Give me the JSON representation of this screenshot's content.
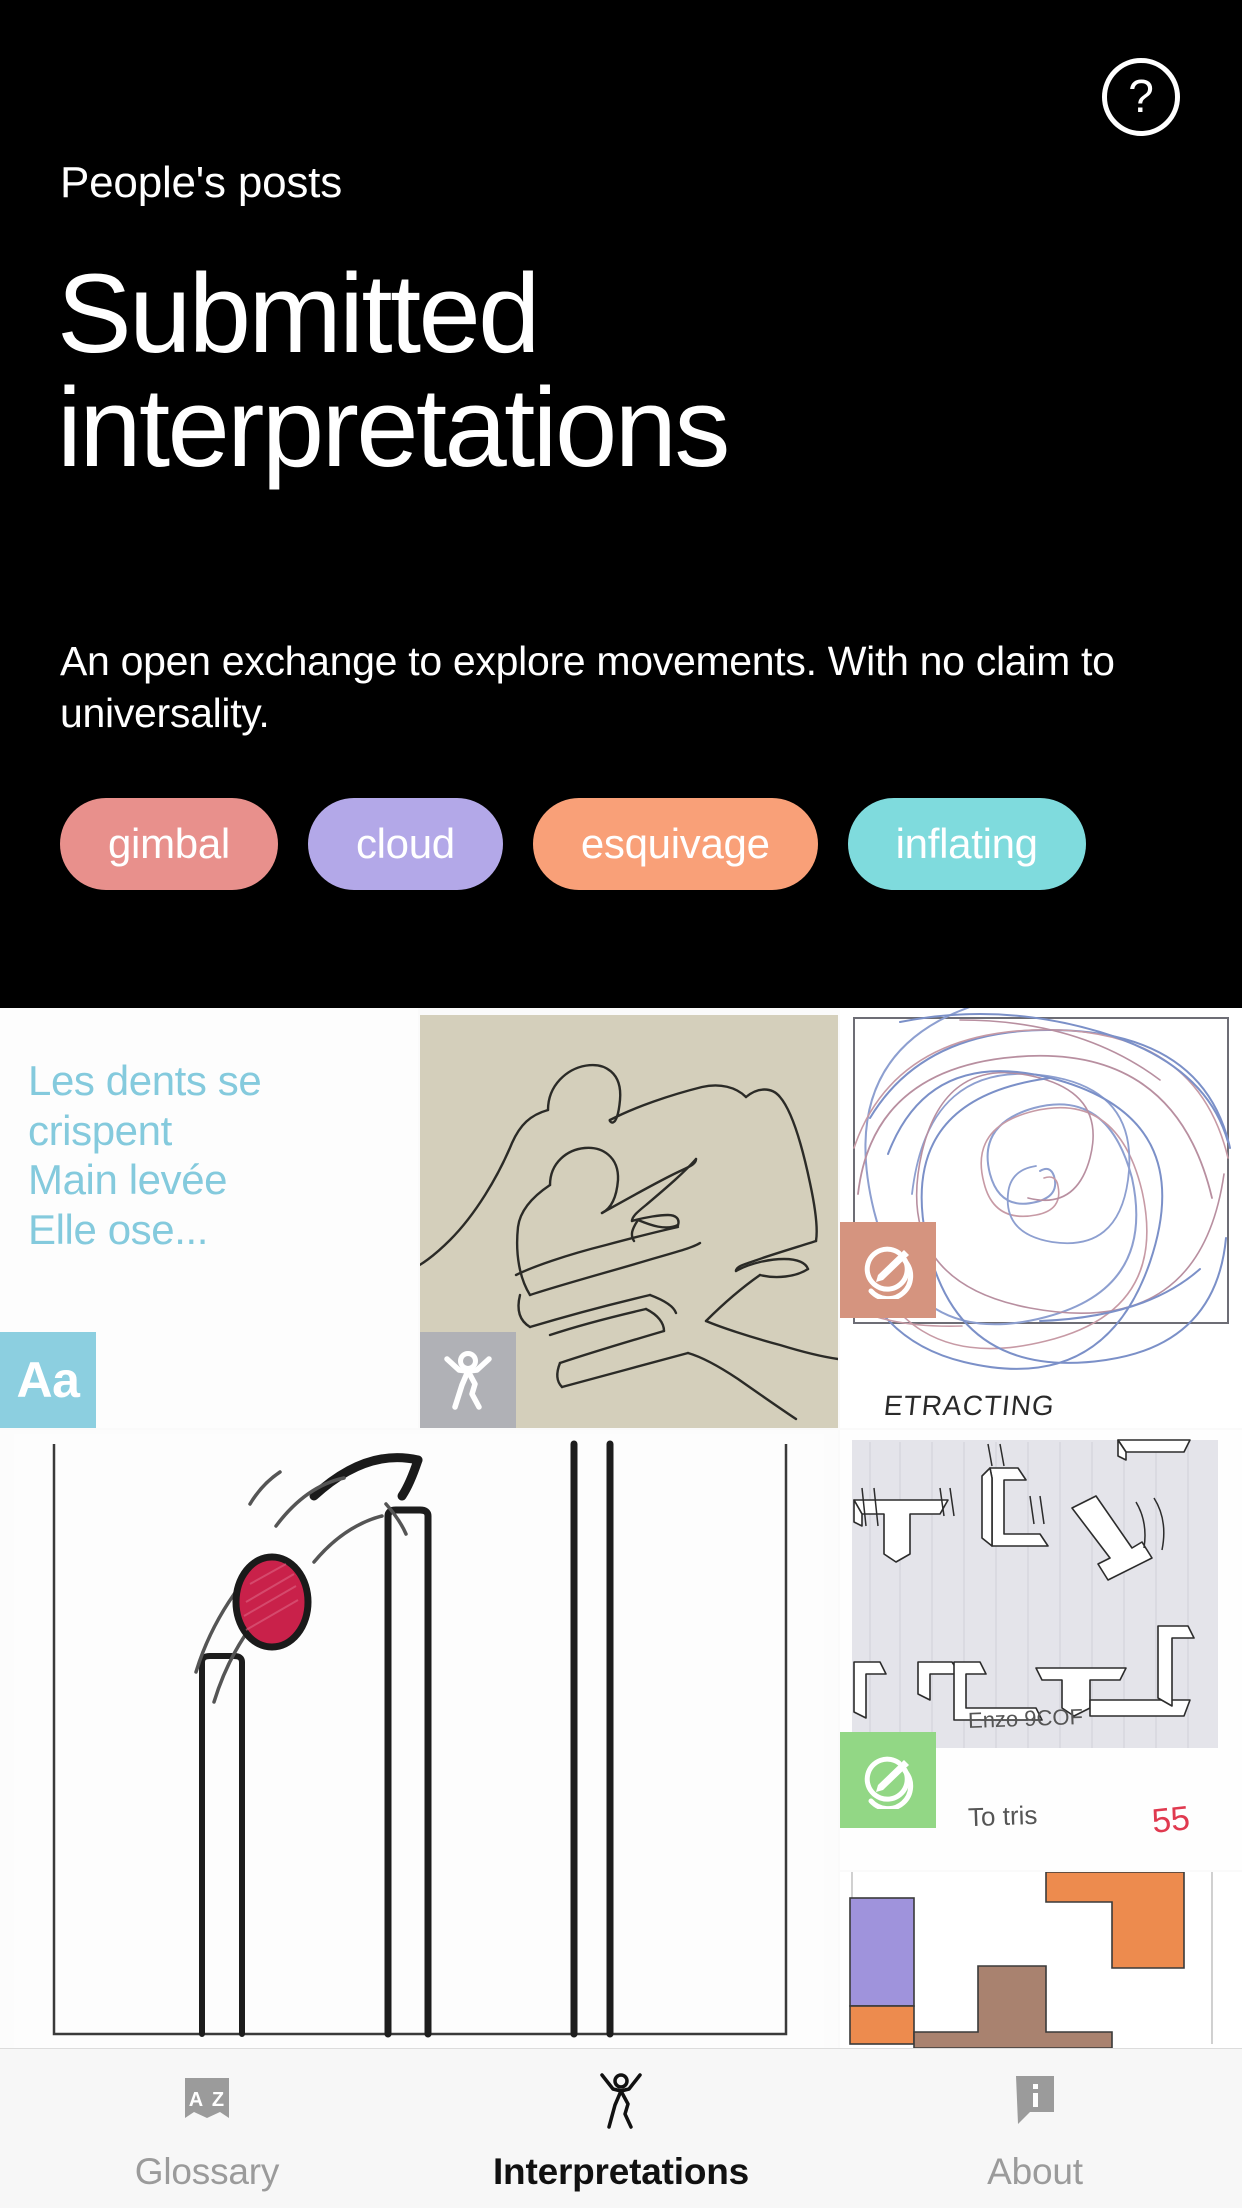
{
  "header": {
    "eyebrow": "People's posts",
    "title": "Submitted interpretations",
    "subtitle": "An open exchange to explore movements. With no claim to universality.",
    "help_icon": "question-mark-circle-icon",
    "background_color": "#000000",
    "tags": [
      {
        "label": "gimbal",
        "color": "#e8908c"
      },
      {
        "label": "cloud",
        "color": "#b3a8e8"
      },
      {
        "label": "esquivage",
        "color": "#f9a078"
      },
      {
        "label": "inflating",
        "color": "#7fdbdd"
      }
    ]
  },
  "grid": {
    "cells": [
      {
        "id": "text-post",
        "kind": "text",
        "text": "Les dents se crispent\nMain levée\nElle ose...",
        "text_color": "#84cadd",
        "badge": {
          "type": "text-icon",
          "label": "Aa",
          "color": "#8ccfe0"
        }
      },
      {
        "id": "figure-drawing",
        "kind": "image",
        "alt": "line drawing of two embracing figures on beige paper",
        "badge": {
          "type": "dancer-icon",
          "label": "",
          "color": "#b0b1b6"
        }
      },
      {
        "id": "spiral-drawing",
        "kind": "image",
        "alt": "blue and red pen spiral on white paper",
        "caption": "ETRACTING",
        "badge": {
          "type": "drawing-icon",
          "label": "",
          "color": "#d5947f"
        }
      },
      {
        "id": "pendulum-drawing",
        "kind": "image",
        "alt": "red ball swinging past three vertical bars",
        "badge": null
      },
      {
        "id": "blocks-drawing",
        "kind": "image",
        "alt": "pencil drawing of 3D tetris-like beams on shaded ground",
        "annotations": {
          "signature": "Enzo  9COF",
          "note": "To tris",
          "mark": "55"
        },
        "badge": {
          "type": "drawing-icon",
          "label": "",
          "color": "#92d785"
        }
      },
      {
        "id": "colored-blocks",
        "kind": "image",
        "alt": "colored pencil tetris blocks purple orange brown",
        "badge": null
      }
    ]
  },
  "tabbar": {
    "tabs": [
      {
        "label": "Glossary",
        "icon": "az-book-icon",
        "active": false
      },
      {
        "label": "Interpretations",
        "icon": "dancer-icon",
        "active": true
      },
      {
        "label": "About",
        "icon": "info-bubble-icon",
        "active": false
      }
    ]
  }
}
